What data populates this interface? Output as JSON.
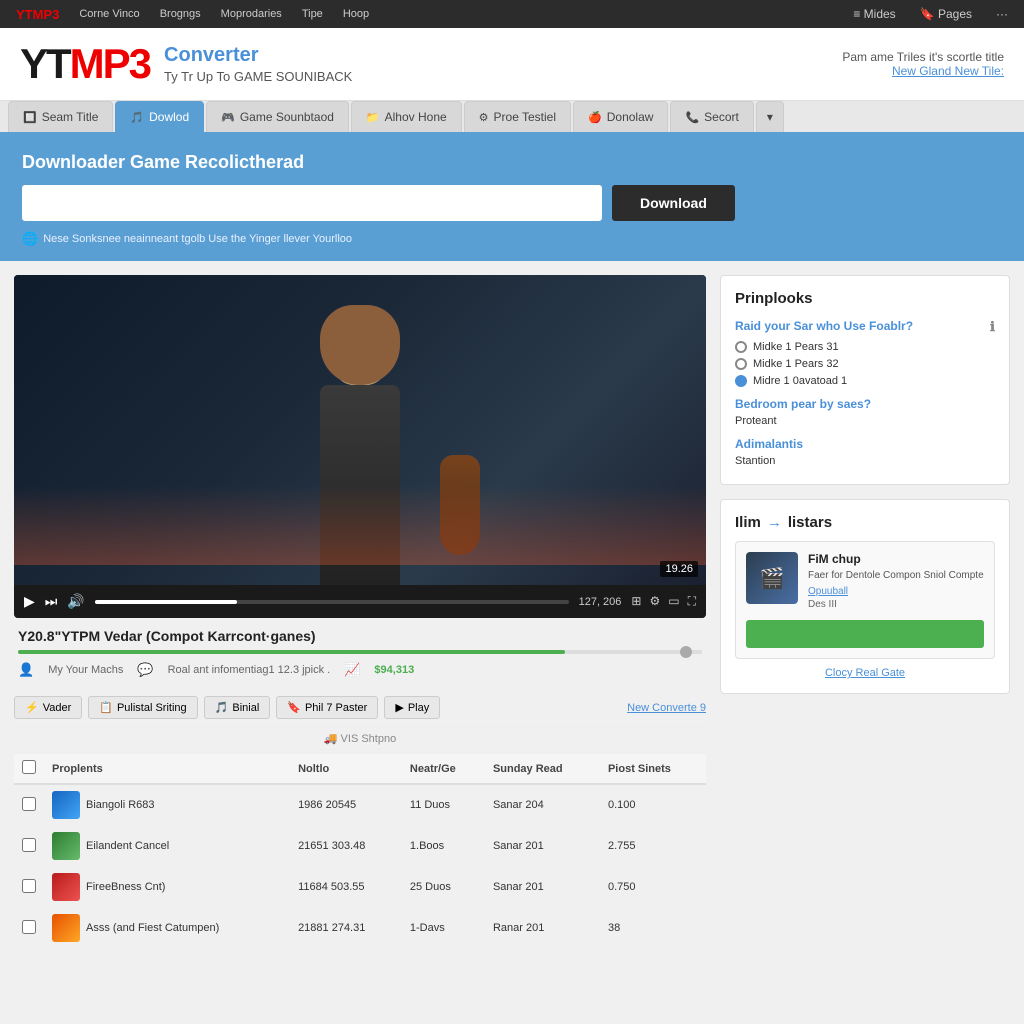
{
  "topnav": {
    "items": [
      "Corne Vinco",
      "Brogngs",
      "Moprodaries",
      "Tipe",
      "Hoop"
    ],
    "right_items": [
      "Mides",
      "Pages",
      "···"
    ]
  },
  "header": {
    "logo_yt": "YT",
    "logo_mp3": "MP3",
    "converter": "Converter",
    "tagline": "Ty Tr Up To GAME SOUNIBACK",
    "search_label": "Pam ame Triles it's scortle title",
    "new_link": "New Gland New Tile:"
  },
  "tabs": [
    {
      "label": "Seam Title",
      "icon": "🔲",
      "active": false
    },
    {
      "label": "Dowlod",
      "icon": "🎵",
      "active": true
    },
    {
      "label": "Game Sounbtaod",
      "icon": "🎮",
      "active": false
    },
    {
      "label": "Alhov Hone",
      "icon": "📁",
      "active": false
    },
    {
      "label": "Proe Testiel",
      "icon": "⚙",
      "active": false
    },
    {
      "label": "Donolaw",
      "icon": "🍎",
      "active": false
    },
    {
      "label": "Secort",
      "icon": "📞",
      "active": false
    }
  ],
  "download_section": {
    "title": "Downloader Game Recolictherad",
    "input_placeholder": "",
    "button_label": "Download",
    "hint": "Nese Sonksnee neainneant tgolb Use the Yinger llever Yourlloo"
  },
  "video": {
    "timestamp": "19.26",
    "time_display": "127, 206",
    "title": "Y20.8\"YTPM Vedar (Compot Karrcont·ganes)",
    "channel": "My Your Machs",
    "meta_info": "Roal ant infomentiag1  12.3 jpick .",
    "views": "$94,313",
    "volume_pct": 80
  },
  "action_buttons": [
    {
      "label": "Vader",
      "icon": "⚡"
    },
    {
      "label": "Pulistal Sriting",
      "icon": "📋"
    },
    {
      "label": "Binial",
      "icon": "🎵"
    },
    {
      "label": "Phil 7 Paster",
      "icon": "🔖"
    },
    {
      "label": "Play",
      "icon": "▶"
    }
  ],
  "convert_link": "New Converte 9",
  "shipping_label": "VIS Shtpno",
  "table": {
    "columns": [
      "Proplents",
      "Noltlo",
      "Neatr/Ge",
      "Sunday Read",
      "Piost Sinets"
    ],
    "rows": [
      {
        "checked": false,
        "thumb_color": "thumb-blue",
        "name": "Biangoli R683",
        "col2": "1986 20545",
        "col3": "11 Duos",
        "col4": "Sanar 204",
        "col5": "0.100"
      },
      {
        "checked": false,
        "thumb_color": "thumb-green",
        "name": "Eilandent Cancel",
        "col2": "21651 303.48",
        "col3": "1.Boos",
        "col4": "Sanar 201",
        "col5": "2.755"
      },
      {
        "checked": false,
        "thumb_color": "thumb-red",
        "name": "FireeBness Cnt)",
        "col2": "11684 503.55",
        "col3": "25 Duos",
        "col4": "Sanar 201",
        "col5": "0.750"
      },
      {
        "checked": false,
        "thumb_color": "thumb-orange",
        "name": "Asss (and Fiest Catumpen)",
        "col2": "21881 274.31",
        "col3": "1-Davs",
        "col4": "Ranar 201",
        "col5": "38"
      }
    ]
  },
  "sidebar": {
    "poll_box": {
      "title": "Prinplooks",
      "question": "Raid your Sar who Use Foablr?",
      "options": [
        {
          "label": "Midke 1 Pears 31",
          "selected": false
        },
        {
          "label": "Midke 1 Pears 32",
          "selected": false
        },
        {
          "label": "Midre 1 0avatoad 1",
          "selected": true
        }
      ],
      "section1_title": "Bedroom pear by saes?",
      "section1_answer": "Proteant",
      "section2_title": "Adimalantis",
      "section2_answer": "Stantion"
    },
    "promo_box": {
      "title": "Ilim",
      "title_arrow": "→",
      "title_suffix": "listars",
      "card": {
        "thumb_icon": "🎬",
        "title": "FiM chup",
        "desc": "Faer for Dentole Compon Sniol Compte",
        "link": "Opuuball",
        "sub": "Des III"
      },
      "green_bar_label": "",
      "footer_link": "Clocy Real Gate"
    }
  }
}
